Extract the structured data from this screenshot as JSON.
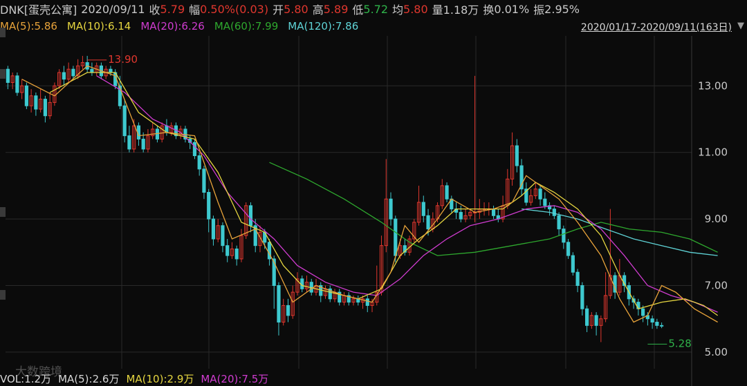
{
  "header": {
    "symbol": "DNK[蛋壳公寓]",
    "date": "2020/09/11",
    "close_label": "收",
    "close": "5.79",
    "change_label": "幅",
    "change": "0.50%(0.03)",
    "open_label": "开",
    "open": "5.80",
    "high_label": "高",
    "high": "5.89",
    "low_label": "低",
    "low": "5.72",
    "avg_label": "均",
    "avg": "5.80",
    "vol_label": "量",
    "vol": "1.18万",
    "turnover_label": "换",
    "turnover": "0.01%",
    "amp_label": "振",
    "amp": "2.95%"
  },
  "ma_legend": [
    {
      "text": "MA(5):5.86",
      "color": "#e8a33a"
    },
    {
      "text": "MA(10):6.14",
      "color": "#e6d640"
    },
    {
      "text": "MA(20):6.26",
      "color": "#d03cd0"
    },
    {
      "text": "MA(60):7.99",
      "color": "#2ea82e"
    },
    {
      "text": "MA(120):7.86",
      "color": "#5fd3d6"
    }
  ],
  "range_label": "2020/01/17-2020/09/11(163日)",
  "volume_bar": {
    "vol": "VOL:1.2万",
    "ma5": "MA(5):2.6万",
    "ma10": "MA(10):2.9万",
    "ma20": "MA(20):7.5万"
  },
  "watermark": "大数跨境",
  "colors": {
    "up": "#e0372e",
    "down": "#3ec9cf",
    "grid": "#2a2a2a",
    "axis_text": "#c9c9c9"
  },
  "chart_data": {
    "type": "candlestick",
    "ylim": [
      4.5,
      14.5
    ],
    "yticks": [
      5.0,
      7.0,
      9.0,
      11.0,
      13.0
    ],
    "ytick_labels": [
      "5.00",
      "7.00",
      "9.00",
      "11.00",
      "13.00"
    ],
    "annotations": [
      {
        "text": "13.90",
        "value": 13.9,
        "candle": 17
      },
      {
        "text": "5.28",
        "value": 5.28,
        "candle": 137
      }
    ],
    "candles": [
      [
        13.5,
        13.1,
        13.6,
        12.9
      ],
      [
        13.1,
        13.3,
        13.4,
        12.9
      ],
      [
        13.3,
        12.8,
        13.4,
        12.7
      ],
      [
        12.8,
        13.0,
        13.2,
        12.6
      ],
      [
        13.0,
        12.4,
        13.1,
        12.3
      ],
      [
        12.4,
        12.7,
        12.9,
        12.2
      ],
      [
        12.7,
        12.3,
        12.8,
        12.1
      ],
      [
        12.3,
        12.6,
        12.9,
        12.2
      ],
      [
        12.6,
        12.1,
        12.7,
        11.9
      ],
      [
        12.1,
        12.5,
        12.8,
        12.0
      ],
      [
        12.5,
        13.0,
        13.1,
        12.4
      ],
      [
        13.0,
        13.4,
        13.5,
        12.9
      ],
      [
        13.4,
        13.2,
        13.6,
        13.0
      ],
      [
        13.2,
        13.5,
        13.7,
        13.1
      ],
      [
        13.5,
        13.3,
        13.6,
        13.2
      ],
      [
        13.3,
        13.6,
        13.8,
        13.2
      ],
      [
        13.6,
        13.7,
        13.9,
        13.5
      ],
      [
        13.7,
        13.5,
        13.9,
        13.4
      ],
      [
        13.5,
        13.4,
        13.7,
        13.3
      ],
      [
        13.4,
        13.6,
        13.7,
        13.3
      ],
      [
        13.6,
        13.3,
        13.7,
        13.2
      ],
      [
        13.3,
        13.5,
        13.6,
        13.2
      ],
      [
        13.5,
        13.4,
        13.6,
        13.3
      ],
      [
        13.4,
        13.0,
        13.5,
        12.9
      ],
      [
        13.0,
        12.4,
        13.3,
        12.3
      ],
      [
        12.4,
        11.5,
        12.6,
        11.3
      ],
      [
        11.5,
        11.1,
        11.8,
        11.0
      ],
      [
        11.1,
        11.8,
        12.0,
        11.0
      ],
      [
        11.8,
        11.4,
        11.9,
        11.2
      ],
      [
        11.4,
        11.1,
        11.6,
        11.0
      ],
      [
        11.1,
        11.5,
        11.7,
        11.0
      ],
      [
        11.5,
        11.7,
        11.9,
        11.4
      ],
      [
        11.7,
        11.4,
        11.8,
        11.3
      ],
      [
        11.4,
        11.8,
        11.9,
        11.3
      ],
      [
        11.8,
        11.6,
        12.0,
        11.5
      ],
      [
        11.6,
        11.8,
        11.9,
        11.5
      ],
      [
        11.8,
        11.5,
        11.9,
        11.4
      ],
      [
        11.5,
        11.7,
        11.8,
        11.4
      ],
      [
        11.7,
        11.4,
        11.8,
        11.3
      ],
      [
        11.4,
        11.3,
        11.5,
        11.1
      ],
      [
        11.3,
        10.9,
        11.4,
        10.8
      ],
      [
        10.9,
        10.5,
        11.0,
        10.3
      ],
      [
        10.5,
        9.8,
        10.6,
        9.6
      ],
      [
        9.8,
        9.0,
        9.9,
        8.6
      ],
      [
        9.0,
        8.4,
        9.1,
        8.2
      ],
      [
        8.4,
        8.8,
        9.0,
        8.3
      ],
      [
        8.8,
        8.2,
        8.9,
        8.0
      ],
      [
        8.2,
        7.9,
        8.4,
        7.7
      ],
      [
        7.9,
        8.1,
        8.3,
        7.8
      ],
      [
        8.1,
        7.8,
        8.2,
        7.6
      ],
      [
        7.8,
        8.5,
        8.7,
        7.7
      ],
      [
        8.5,
        9.4,
        9.5,
        8.4
      ],
      [
        9.4,
        8.8,
        9.5,
        8.6
      ],
      [
        8.8,
        8.2,
        9.0,
        8.0
      ],
      [
        8.2,
        8.6,
        8.8,
        8.0
      ],
      [
        8.6,
        8.3,
        8.7,
        8.1
      ],
      [
        8.3,
        7.8,
        8.4,
        7.6
      ],
      [
        7.8,
        7.0,
        7.9,
        6.3
      ],
      [
        7.0,
        5.9,
        7.1,
        5.5
      ],
      [
        5.9,
        6.4,
        6.6,
        5.8
      ],
      [
        6.4,
        6.1,
        6.6,
        5.9
      ],
      [
        6.1,
        6.8,
        7.0,
        6.0
      ],
      [
        6.8,
        7.2,
        7.4,
        6.7
      ],
      [
        7.2,
        6.9,
        7.3,
        6.8
      ],
      [
        6.9,
        7.1,
        7.3,
        6.8
      ],
      [
        7.1,
        6.8,
        7.2,
        6.7
      ],
      [
        6.8,
        7.0,
        7.2,
        6.7
      ],
      [
        7.0,
        6.7,
        7.1,
        6.5
      ],
      [
        6.7,
        6.9,
        7.0,
        6.6
      ],
      [
        6.9,
        6.6,
        7.0,
        6.5
      ],
      [
        6.6,
        6.8,
        6.9,
        6.5
      ],
      [
        6.8,
        6.5,
        6.9,
        6.4
      ],
      [
        6.5,
        6.7,
        6.8,
        6.4
      ],
      [
        6.7,
        6.5,
        6.8,
        6.4
      ],
      [
        6.5,
        6.6,
        6.7,
        6.4
      ],
      [
        6.6,
        6.5,
        6.7,
        6.4
      ],
      [
        6.5,
        6.6,
        6.7,
        6.3
      ],
      [
        6.6,
        6.4,
        6.7,
        6.2
      ],
      [
        6.4,
        6.5,
        6.6,
        6.2
      ],
      [
        6.5,
        6.8,
        7.6,
        6.4
      ],
      [
        6.8,
        8.2,
        8.5,
        6.7
      ],
      [
        8.2,
        9.6,
        10.8,
        8.0
      ],
      [
        9.6,
        9.0,
        9.8,
        8.8
      ],
      [
        9.0,
        7.9,
        9.1,
        7.7
      ],
      [
        7.9,
        8.2,
        8.4,
        7.8
      ],
      [
        8.2,
        8.0,
        8.4,
        7.9
      ],
      [
        8.0,
        8.4,
        8.5,
        7.9
      ],
      [
        8.4,
        8.9,
        9.0,
        8.3
      ],
      [
        8.9,
        9.5,
        10.0,
        8.8
      ],
      [
        9.5,
        9.1,
        9.7,
        8.9
      ],
      [
        9.1,
        8.7,
        9.3,
        8.5
      ],
      [
        8.7,
        9.0,
        9.2,
        8.6
      ],
      [
        9.0,
        9.4,
        9.5,
        8.9
      ],
      [
        9.4,
        10.0,
        10.2,
        9.3
      ],
      [
        10.0,
        9.6,
        10.1,
        9.5
      ],
      [
        9.6,
        9.3,
        9.7,
        9.2
      ],
      [
        9.3,
        9.2,
        9.5,
        9.0
      ],
      [
        9.2,
        9.0,
        9.4,
        8.9
      ],
      [
        9.0,
        9.1,
        9.3,
        8.9
      ],
      [
        9.1,
        9.2,
        9.3,
        9.0
      ],
      [
        9.2,
        9.2,
        13.3,
        8.9
      ],
      [
        9.2,
        9.3,
        9.6,
        9.0
      ],
      [
        9.3,
        9.3,
        9.5,
        9.1
      ],
      [
        9.3,
        9.3,
        9.5,
        9.1
      ],
      [
        9.3,
        9.1,
        9.4,
        9.0
      ],
      [
        9.1,
        9.0,
        9.3,
        8.9
      ],
      [
        9.0,
        9.4,
        9.7,
        8.9
      ],
      [
        9.4,
        10.2,
        10.5,
        9.3
      ],
      [
        10.2,
        11.2,
        11.6,
        10.0
      ],
      [
        11.2,
        10.6,
        11.4,
        10.4
      ],
      [
        10.6,
        9.9,
        10.8,
        9.7
      ],
      [
        9.9,
        9.5,
        10.1,
        9.4
      ],
      [
        9.5,
        9.7,
        9.9,
        9.4
      ],
      [
        9.7,
        9.9,
        10.1,
        9.6
      ],
      [
        9.9,
        9.6,
        10.0,
        9.4
      ],
      [
        9.6,
        9.4,
        9.8,
        9.3
      ],
      [
        9.4,
        9.3,
        9.5,
        9.1
      ],
      [
        9.3,
        9.1,
        9.4,
        9.0
      ],
      [
        9.1,
        8.7,
        9.2,
        8.5
      ],
      [
        8.7,
        8.3,
        8.8,
        8.1
      ],
      [
        8.3,
        7.9,
        8.4,
        7.8
      ],
      [
        7.9,
        7.4,
        8.0,
        7.3
      ],
      [
        7.4,
        7.0,
        7.5,
        6.8
      ],
      [
        7.0,
        6.3,
        7.1,
        6.1
      ],
      [
        6.3,
        5.8,
        6.4,
        5.6
      ],
      [
        5.8,
        6.1,
        6.2,
        5.7
      ],
      [
        6.1,
        5.8,
        6.2,
        5.5
      ],
      [
        5.8,
        6.0,
        6.1,
        5.3
      ],
      [
        6.0,
        6.7,
        7.4,
        5.9
      ],
      [
        6.7,
        7.3,
        9.3,
        6.6
      ],
      [
        7.3,
        6.8,
        7.4,
        6.6
      ],
      [
        6.8,
        7.3,
        7.8,
        6.7
      ],
      [
        7.3,
        7.0,
        7.4,
        6.8
      ],
      [
        7.0,
        6.6,
        7.1,
        6.4
      ],
      [
        6.6,
        6.5,
        6.7,
        6.3
      ],
      [
        6.5,
        6.3,
        6.6,
        6.1
      ],
      [
        6.3,
        6.1,
        6.4,
        5.9
      ],
      [
        6.1,
        6.0,
        6.2,
        5.8
      ],
      [
        6.0,
        5.9,
        6.1,
        5.7
      ],
      [
        5.9,
        5.8,
        6.0,
        5.7
      ],
      [
        5.8,
        5.79,
        5.89,
        5.72
      ]
    ],
    "ma5": [
      [
        3,
        13.2
      ],
      [
        10,
        12.7
      ],
      [
        17,
        13.6
      ],
      [
        23,
        13.3
      ],
      [
        28,
        11.5
      ],
      [
        34,
        11.6
      ],
      [
        40,
        11.5
      ],
      [
        45,
        9.5
      ],
      [
        48,
        8.4
      ],
      [
        53,
        8.7
      ],
      [
        57,
        7.7
      ],
      [
        61,
        6.5
      ],
      [
        66,
        7.0
      ],
      [
        72,
        6.7
      ],
      [
        78,
        6.5
      ],
      [
        82,
        7.4
      ],
      [
        85,
        8.8
      ],
      [
        88,
        8.3
      ],
      [
        92,
        9.0
      ],
      [
        95,
        9.6
      ],
      [
        100,
        9.2
      ],
      [
        104,
        9.3
      ],
      [
        108,
        9.5
      ],
      [
        111,
        10.3
      ],
      [
        114,
        10.0
      ],
      [
        118,
        9.6
      ],
      [
        122,
        8.9
      ],
      [
        127,
        7.9
      ],
      [
        131,
        6.6
      ],
      [
        134,
        5.9
      ],
      [
        137,
        6.1
      ],
      [
        140,
        7.0
      ],
      [
        143,
        6.8
      ],
      [
        147,
        6.3
      ],
      [
        152,
        5.9
      ]
    ],
    "ma10": [
      [
        9,
        12.8
      ],
      [
        17,
        13.4
      ],
      [
        23,
        13.4
      ],
      [
        28,
        12.2
      ],
      [
        34,
        11.6
      ],
      [
        40,
        11.4
      ],
      [
        45,
        10.4
      ],
      [
        50,
        8.9
      ],
      [
        55,
        8.6
      ],
      [
        59,
        7.6
      ],
      [
        63,
        7.0
      ],
      [
        69,
        6.8
      ],
      [
        75,
        6.6
      ],
      [
        80,
        6.9
      ],
      [
        84,
        7.9
      ],
      [
        88,
        8.4
      ],
      [
        92,
        8.8
      ],
      [
        96,
        9.3
      ],
      [
        100,
        9.3
      ],
      [
        106,
        9.3
      ],
      [
        110,
        9.7
      ],
      [
        113,
        10.1
      ],
      [
        117,
        9.8
      ],
      [
        122,
        9.3
      ],
      [
        127,
        8.5
      ],
      [
        131,
        7.3
      ],
      [
        135,
        6.3
      ],
      [
        140,
        6.5
      ],
      [
        145,
        6.6
      ],
      [
        149,
        6.4
      ],
      [
        152,
        6.1
      ]
    ],
    "ma20": [
      [
        19,
        13.3
      ],
      [
        25,
        12.8
      ],
      [
        31,
        12.0
      ],
      [
        37,
        11.6
      ],
      [
        42,
        10.9
      ],
      [
        47,
        9.8
      ],
      [
        52,
        9.0
      ],
      [
        57,
        8.4
      ],
      [
        62,
        7.6
      ],
      [
        68,
        7.1
      ],
      [
        74,
        6.8
      ],
      [
        79,
        6.7
      ],
      [
        84,
        7.2
      ],
      [
        89,
        7.9
      ],
      [
        94,
        8.4
      ],
      [
        99,
        8.8
      ],
      [
        105,
        9.0
      ],
      [
        111,
        9.3
      ],
      [
        117,
        9.4
      ],
      [
        122,
        9.2
      ],
      [
        127,
        8.7
      ],
      [
        132,
        7.9
      ],
      [
        137,
        7.0
      ],
      [
        142,
        6.7
      ],
      [
        147,
        6.5
      ],
      [
        152,
        6.2
      ]
    ],
    "ma60": [
      [
        56,
        10.7
      ],
      [
        64,
        10.2
      ],
      [
        72,
        9.6
      ],
      [
        80,
        8.9
      ],
      [
        86,
        8.3
      ],
      [
        92,
        7.9
      ],
      [
        100,
        8.0
      ],
      [
        108,
        8.2
      ],
      [
        116,
        8.4
      ],
      [
        122,
        8.7
      ],
      [
        127,
        8.9
      ],
      [
        133,
        8.7
      ],
      [
        140,
        8.6
      ],
      [
        146,
        8.4
      ],
      [
        152,
        8.0
      ]
    ],
    "ma120": [
      [
        110,
        9.3
      ],
      [
        116,
        9.2
      ],
      [
        122,
        9.0
      ],
      [
        128,
        8.7
      ],
      [
        134,
        8.4
      ],
      [
        140,
        8.2
      ],
      [
        146,
        8.0
      ],
      [
        152,
        7.9
      ]
    ]
  }
}
